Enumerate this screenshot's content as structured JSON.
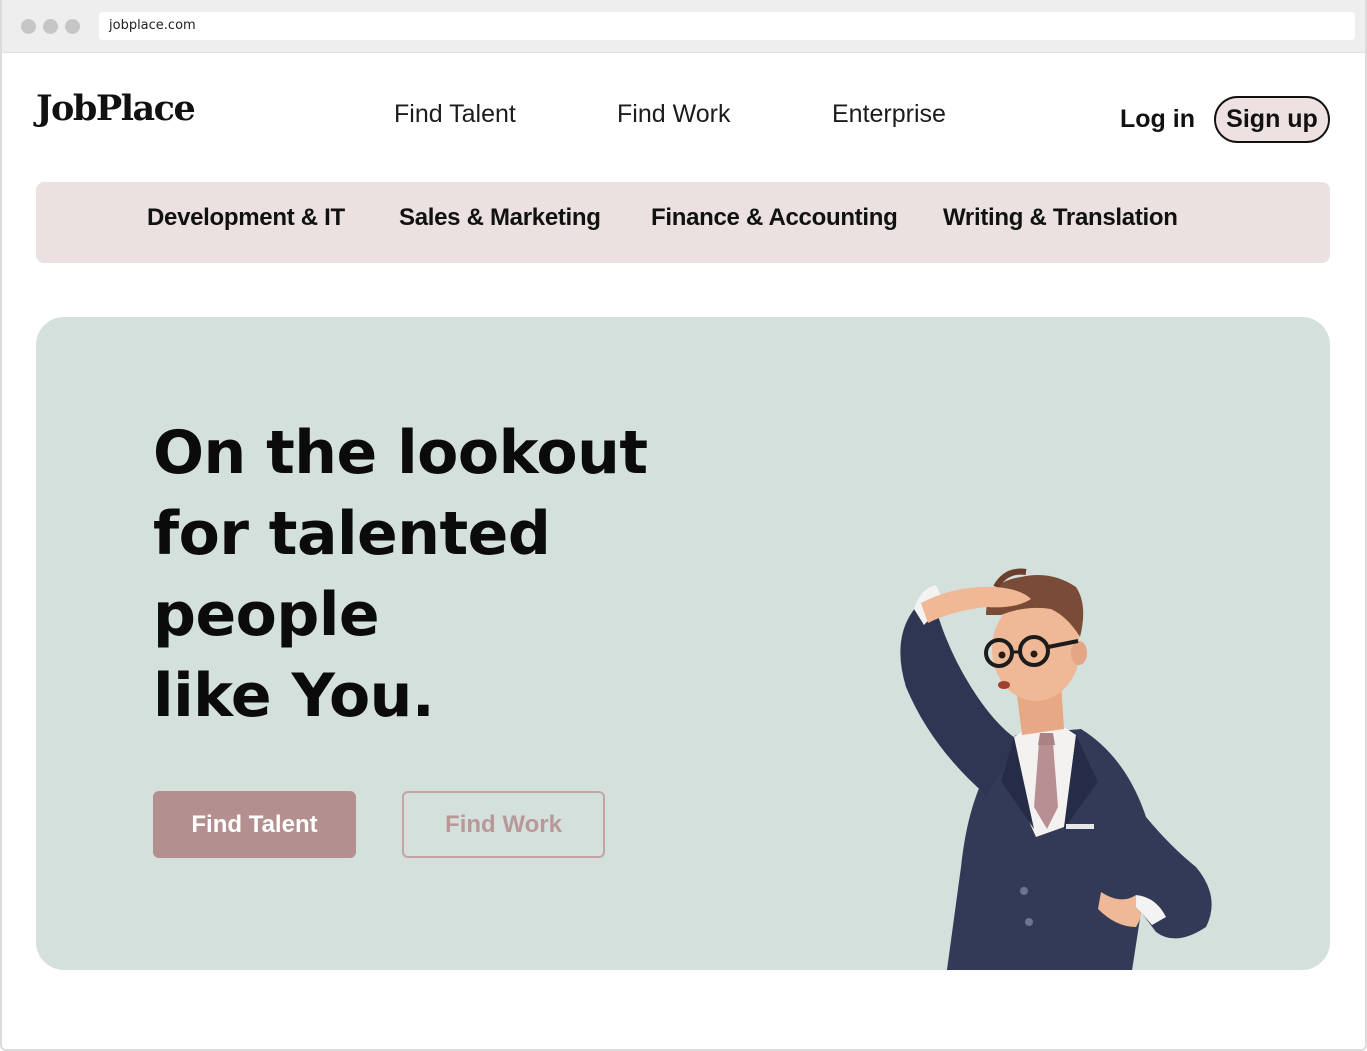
{
  "browser": {
    "url": "jobplace.com"
  },
  "header": {
    "logo": "JobPlace",
    "nav": [
      {
        "label": "Find Talent"
      },
      {
        "label": "Find Work"
      },
      {
        "label": "Enterprise"
      }
    ],
    "login_label": "Log in",
    "signup_label": "Sign up"
  },
  "categories": [
    {
      "label": "Development & IT"
    },
    {
      "label": "Sales & Marketing"
    },
    {
      "label": "Finance & Accounting"
    },
    {
      "label": "Writing & Translation"
    }
  ],
  "hero": {
    "headline_lines": [
      "On the lookout",
      "for talented",
      "people",
      "like You."
    ],
    "primary_button": "Find Talent",
    "secondary_button": "Find Work",
    "illustration": "businessman-looking-out-illustration"
  },
  "colors": {
    "accent": "#b48f8f",
    "category_bar": "#ebe1e1",
    "hero_bg": "#d4e0dc"
  }
}
